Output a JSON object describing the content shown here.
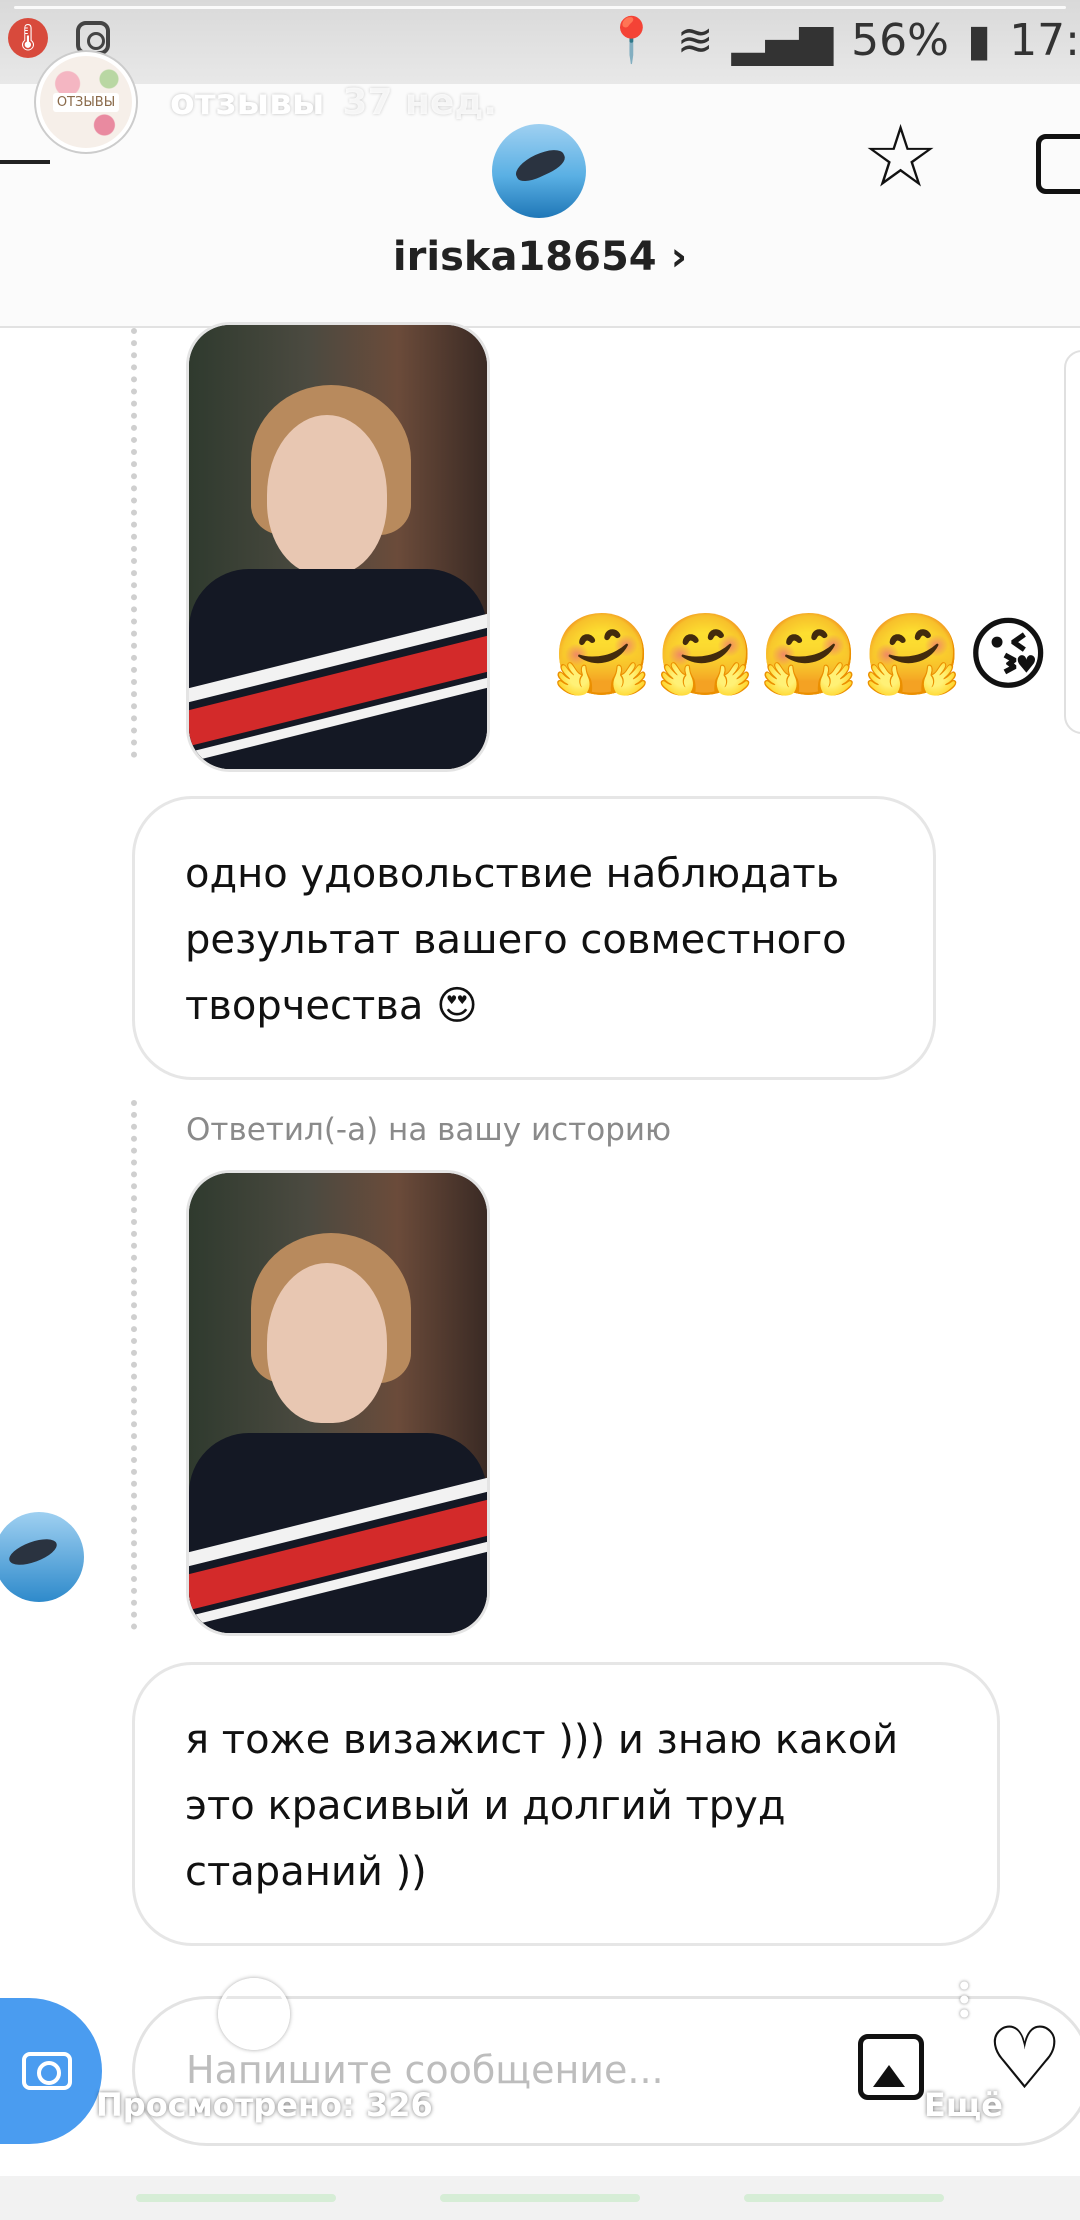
{
  "story": {
    "account_name": "отзывы",
    "time_ago": "37 нед.",
    "avatar_text": "ОТЗЫВЫ"
  },
  "status_bar": {
    "battery": "56%",
    "time": "17:"
  },
  "dm_header": {
    "username": "iriska18654",
    "chevron": "›"
  },
  "messages": {
    "emojis": "🤗🤗🤗🤗😘",
    "bubble1": "одно удовольствие наблюдать результат вашего совместного творчества 😍",
    "reply_caption": "Ответил(-а) на вашу историю",
    "bubble2": "я тоже визажист ))) и знаю какой это красивый и долгий труд стараний ))"
  },
  "composer": {
    "placeholder": "Напишите сообщение..."
  },
  "story_footer": {
    "views_label": "Просмотрено: 326",
    "more_label": "Ещё"
  },
  "icons": [
    "camera-icon",
    "gallery-icon",
    "heart-icon",
    "star-icon",
    "back-icon"
  ]
}
